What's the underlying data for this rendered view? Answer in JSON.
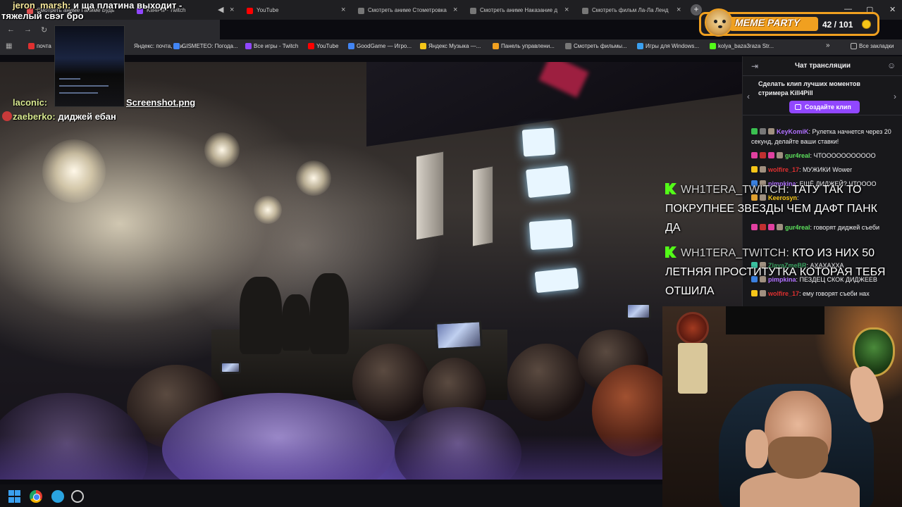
{
  "browser": {
    "tabs": [
      {
        "label": "Смотреть аниме Ганиме Будь",
        "color": "#e05050"
      },
      {
        "label": "Kill4Pill - Twitch",
        "color": "#9147ff"
      },
      {
        "label": "YouTube",
        "color": "#ff0000"
      },
      {
        "label": "Смотреть аниме Стометровка",
        "color": "#777777"
      },
      {
        "label": "Смотреть аниме Наказание д",
        "color": "#777777"
      },
      {
        "label": "Смотреть фильм Ла-Ла Ленд",
        "color": "#777777"
      }
    ],
    "tab_close": "×",
    "new_tab": "+",
    "window_controls": {
      "minimize": "—",
      "maximize": "▢",
      "close": "✕"
    },
    "nav": {
      "back": "←",
      "forward": "→",
      "reload": "↻"
    },
    "bookmarks": [
      {
        "label": "почта",
        "color": "#e03030"
      },
      {
        "label": "Яндекс: почта, пои...",
        "color": "#e03030"
      },
      {
        "label": "GISMETEO: Погода...",
        "color": "#4285f4"
      },
      {
        "label": "Все игры - Twitch",
        "color": "#9147ff"
      },
      {
        "label": "YouTube",
        "color": "#ff0000"
      },
      {
        "label": "GoodGame — Игро...",
        "color": "#4285f4"
      },
      {
        "label": "Яндекс Музыка —...",
        "color": "#f5c518"
      },
      {
        "label": "Панель управлени...",
        "color": "#f0a020"
      },
      {
        "label": "Смотреть фильмы...",
        "color": "#777777"
      },
      {
        "label": "Игры для Windows...",
        "color": "#3aa0f0"
      },
      {
        "label": "kolya_baza3raza Str...",
        "color": "#53fc18"
      }
    ],
    "bookmarks_more": "»",
    "all_bookmarks": "Все закладки"
  },
  "overlay_chat": [
    {
      "user": "jeron_marsh:",
      "text": "и ща платина выходит -"
    },
    {
      "user": "",
      "text": "тяжелый свэг бро"
    },
    {
      "user": "laconic:",
      "text": "Screenshot.png"
    },
    {
      "user": "zaeberko:",
      "text": "диджей ебан"
    }
  ],
  "meme_party": {
    "title": "MEME PARTY",
    "count": "42 / 101",
    "progress": 0.42
  },
  "twitch_chat": {
    "title": "Чат трансляции",
    "clip_prompt": "Сделать клип лучших моментов стримера Kill4Pill",
    "clip_button": "Создайте клип",
    "messages": [
      {
        "user": "KeyKomiK",
        "color": "#b070ff",
        "text": ": Рулетка начнется через 20 секунд, делайте ваши ставки!"
      },
      {
        "user": "gur4real",
        "color": "#5ce05c",
        "text": ": ЧТООООООООООО"
      },
      {
        "user": "wolfire_17",
        "color": "#e03030",
        "text": ": МУЖИКИ Wower"
      },
      {
        "user": "pimpkina",
        "color": "#b070ff",
        "text": ": ЕЩЁ ДИДЖЕЙ? ЧТОООО"
      },
      {
        "user": "Keerosyn",
        "color": "#f5c518",
        "text": ":"
      },
      {
        "user": "gur4real",
        "color": "#5ce05c",
        "text": ": говорят диджей съеби"
      },
      {
        "user": "ZlayaZmeBR",
        "color": "#3aa060",
        "text": ": АХАХАХХА"
      },
      {
        "user": "pimpkina",
        "color": "#b070ff",
        "text": ": ПЕЗДЕЦ СКОК ДИДЖЕЕВ"
      },
      {
        "user": "wolfire_17",
        "color": "#e03030",
        "text": ": ему говорят съеби нах"
      }
    ]
  },
  "big_overlay": [
    {
      "user": "WH1TERA_TWITCH:",
      "text": "ТАТУ ТАК ТО ПОКРУПНЕЕ ЗВЕЗДЫ ЧЕМ ДАФТ ПАНК ДА"
    },
    {
      "user": "WH1TERA_TWITCH:",
      "text": "КТО ИЗ НИХ 50 ЛЕТНЯЯ ПРОСТИТУТКА КОТОРАЯ ТЕБЯ ОТШИЛА"
    }
  ]
}
